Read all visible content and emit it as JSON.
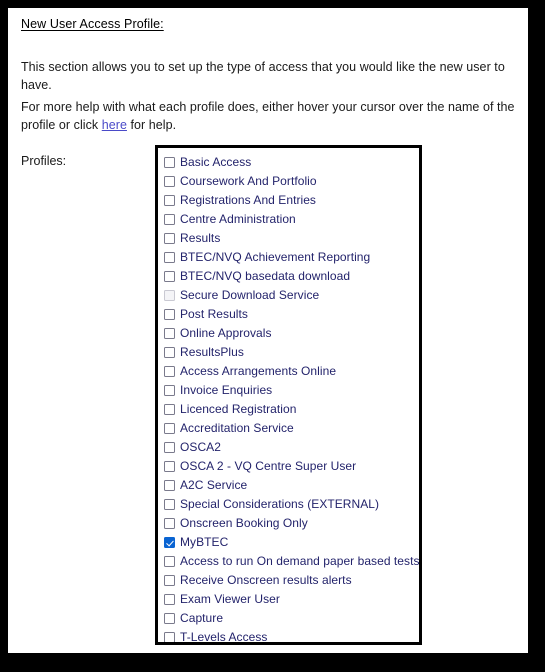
{
  "page": {
    "heading": "New User Access Profile:",
    "paragraph_1": "This section allows you to set up the type of access that you would like the new user to have.",
    "paragraph_2_before": "For more help with what each profile does, either hover your cursor over the name of the profile or click ",
    "help_link_text": "here",
    "paragraph_2_after": " for help.",
    "profiles_label": "Profiles:"
  },
  "colors": {
    "page_border": "#000000",
    "page_background": "#ffffff",
    "heading_text": "#000000",
    "body_text": "#1a1a1a",
    "link": "#4a4ac8",
    "profile_label_text": "#23236b",
    "checkbox_border": "#7a7a8c",
    "checkbox_checked_fill": "#0a64d2",
    "checkbox_disabled_border": "#c9c9d2",
    "listbox_border": "#000000"
  },
  "profiles": {
    "items": [
      {
        "label": "Basic Access",
        "checked": false,
        "disabled": false
      },
      {
        "label": "Coursework And Portfolio",
        "checked": false,
        "disabled": false
      },
      {
        "label": "Registrations And Entries",
        "checked": false,
        "disabled": false
      },
      {
        "label": "Centre Administration",
        "checked": false,
        "disabled": false
      },
      {
        "label": "Results",
        "checked": false,
        "disabled": false
      },
      {
        "label": "BTEC/NVQ Achievement Reporting",
        "checked": false,
        "disabled": false
      },
      {
        "label": "BTEC/NVQ basedata download",
        "checked": false,
        "disabled": false
      },
      {
        "label": "Secure Download Service",
        "checked": false,
        "disabled": true
      },
      {
        "label": "Post Results",
        "checked": false,
        "disabled": false
      },
      {
        "label": "Online Approvals",
        "checked": false,
        "disabled": false
      },
      {
        "label": "ResultsPlus",
        "checked": false,
        "disabled": false
      },
      {
        "label": "Access Arrangements Online",
        "checked": false,
        "disabled": false
      },
      {
        "label": "Invoice Enquiries",
        "checked": false,
        "disabled": false
      },
      {
        "label": "Licenced Registration",
        "checked": false,
        "disabled": false
      },
      {
        "label": "Accreditation Service",
        "checked": false,
        "disabled": false
      },
      {
        "label": "OSCA2",
        "checked": false,
        "disabled": false
      },
      {
        "label": "OSCA 2 - VQ Centre Super User",
        "checked": false,
        "disabled": false
      },
      {
        "label": "A2C Service",
        "checked": false,
        "disabled": false
      },
      {
        "label": "Special Considerations (EXTERNAL)",
        "checked": false,
        "disabled": false
      },
      {
        "label": "Onscreen Booking Only",
        "checked": false,
        "disabled": false
      },
      {
        "label": "MyBTEC",
        "checked": true,
        "disabled": false
      },
      {
        "label": "Access to run On demand paper based tests",
        "checked": false,
        "disabled": false
      },
      {
        "label": "Receive Onscreen results alerts",
        "checked": false,
        "disabled": false
      },
      {
        "label": "Exam Viewer User",
        "checked": false,
        "disabled": false
      },
      {
        "label": "Capture",
        "checked": false,
        "disabled": false
      },
      {
        "label": "T-Levels Access",
        "checked": false,
        "disabled": false
      }
    ]
  }
}
